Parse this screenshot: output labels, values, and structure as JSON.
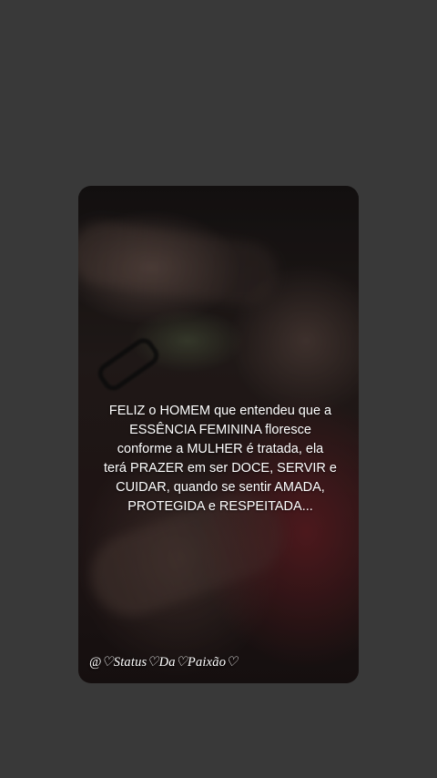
{
  "story": {
    "quote": "FELIZ o HOMEM que entendeu que a\nESSÊNCIA FEMININA floresce\nconforme a MULHER é tratada, ela\nterá PRAZER em ser DOCE, SERVIR e\nCUIDAR, quando se sentir AMADA,\nPROTEGIDA e RESPEITADA...",
    "signature": "@♡Status♡Da♡Paixão♡"
  },
  "colors": {
    "background": "#393939",
    "text": "#ffffff"
  }
}
